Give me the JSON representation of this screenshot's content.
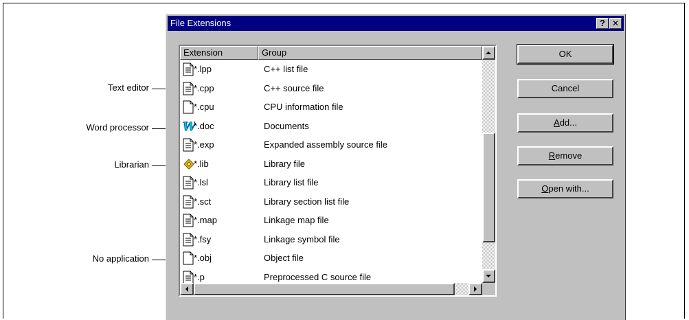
{
  "callouts": [
    {
      "id": "text-editor",
      "label": "Text editor"
    },
    {
      "id": "word-processor",
      "label": "Word processor"
    },
    {
      "id": "librarian",
      "label": "Librarian"
    },
    {
      "id": "no-application",
      "label": "No application"
    }
  ],
  "dialog": {
    "title": "File Extensions",
    "help_button": "?",
    "close_button": "✕",
    "columns": {
      "extension": "Extension",
      "group": "Group"
    },
    "rows": [
      {
        "ext": "*.lpp",
        "group": "C++ list file",
        "icon": "text-document-icon"
      },
      {
        "ext": "*.cpp",
        "group": "C++ source file",
        "icon": "text-document-icon"
      },
      {
        "ext": "*.cpu",
        "group": "CPU information file",
        "icon": "blank-document-icon"
      },
      {
        "ext": "*.doc",
        "group": "Documents",
        "icon": "word-processor-icon"
      },
      {
        "ext": "*.exp",
        "group": "Expanded assembly source file",
        "icon": "text-document-icon"
      },
      {
        "ext": "*.lib",
        "group": "Library file",
        "icon": "librarian-icon"
      },
      {
        "ext": "*.lsl",
        "group": "Library list file",
        "icon": "text-document-icon"
      },
      {
        "ext": "*.sct",
        "group": "Library section list file",
        "icon": "text-document-icon"
      },
      {
        "ext": "*.map",
        "group": "Linkage map file",
        "icon": "text-document-icon"
      },
      {
        "ext": "*.fsy",
        "group": "Linkage symbol file",
        "icon": "text-document-icon"
      },
      {
        "ext": "*.obj",
        "group": "Object file",
        "icon": "blank-document-icon"
      },
      {
        "ext": "*.p",
        "group": "Preprocessed C source file",
        "icon": "text-document-icon"
      }
    ],
    "buttons": {
      "ok": "OK",
      "cancel": "Cancel",
      "add_prefix": "A",
      "add_rest": "dd...",
      "remove_prefix": "R",
      "remove_rest": "emove",
      "open_prefix": "O",
      "open_rest": "pen with..."
    }
  }
}
